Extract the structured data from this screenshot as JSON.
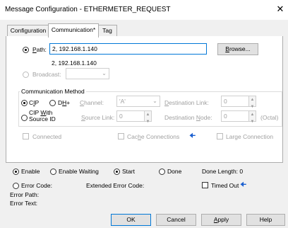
{
  "window": {
    "title": "Message Configuration - ETHERMETER_REQUEST",
    "close_glyph": "✕"
  },
  "tabs": [
    {
      "label": "Configuration",
      "active": false
    },
    {
      "label": "Communication*",
      "active": true
    },
    {
      "label": "Tag",
      "active": false
    }
  ],
  "path": {
    "label_pre": "",
    "label_u": "P",
    "label_post": "ath:",
    "value": "2, 192.168.1.140",
    "resolved": "2, 192.168.1.140",
    "browse_u": "B",
    "browse_rest": "rowse..."
  },
  "broadcast": {
    "label": "Broadcast:"
  },
  "comm_method": {
    "group_label": "Communication Method",
    "cip_u": "I",
    "cip_pre": "C",
    "cip_post": "P",
    "dhp_pre": "D",
    "dhp_u": "H",
    "dhp_post": "+",
    "channel_u": "C",
    "channel_rest": "hannel:",
    "channel_value": "'A'",
    "dest_link_u": "D",
    "dest_link_rest": "estination Link:",
    "dest_link_value": "0",
    "cip_source_line1_pre": "CIP ",
    "cip_source_line1_u": "W",
    "cip_source_line1_post": "ith",
    "cip_source_line2": "Source ID",
    "source_link_pre": "",
    "source_link_u": "S",
    "source_link_rest": "ource Link:",
    "source_link_value": "0",
    "dest_node_pre": "Destination ",
    "dest_node_u": "N",
    "dest_node_rest": "ode:",
    "dest_node_value": "0",
    "octal": "(Octal)"
  },
  "options": {
    "connected": "Connected",
    "cache_pre": "Cac",
    "cache_u": "h",
    "cache_post": "e Connections",
    "large": "Large Connection"
  },
  "status": {
    "enable": "Enable",
    "enable_waiting": "Enable Waiting",
    "start": "Start",
    "done": "Done",
    "done_length": "Done Length: 0",
    "error_code": "Error Code:",
    "extended_error": "Extended Error Code:",
    "timed_out": "Timed Out",
    "error_path": "Error Path:",
    "error_text": "Error Text:"
  },
  "buttons": {
    "ok": "OK",
    "cancel": "Cancel",
    "apply_u": "A",
    "apply_rest": "pply",
    "help": "Help"
  },
  "icons": {
    "arrow": "left-arrow-icon",
    "accent": "#0078d7",
    "arrow_color": "#1a5fd0"
  }
}
